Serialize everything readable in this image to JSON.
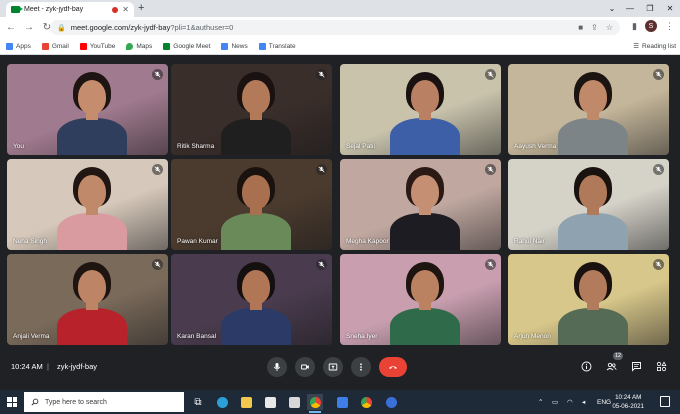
{
  "browser": {
    "tab_title": "Meet - zyk-jydf-bay",
    "new_tab_glyph": "+",
    "url_main": "meet.google.com/zyk-jydf-bay",
    "url_query": "?pli=1&authuser=0",
    "profile_initial": "S",
    "bookmarks": [
      {
        "label": "Apps",
        "icon": "apps-grid-icon",
        "color": "#4285f4"
      },
      {
        "label": "Gmail",
        "icon": "gmail-icon",
        "color": "#ea4335"
      },
      {
        "label": "YouTube",
        "icon": "youtube-icon",
        "color": "#ff0000"
      },
      {
        "label": "Maps",
        "icon": "maps-icon",
        "color": "#34a853"
      },
      {
        "label": "Google Meet",
        "icon": "meet-icon",
        "color": "#00832d"
      },
      {
        "label": "News",
        "icon": "news-icon",
        "color": "#4285f4"
      },
      {
        "label": "Translate",
        "icon": "translate-icon",
        "color": "#4285f4"
      }
    ],
    "reading_list": "Reading list"
  },
  "meet": {
    "participants": [
      {
        "name": "You",
        "bg": "#a07a8e",
        "skin": "#c58c6e",
        "hair": "#1e1412",
        "shirt": "#2f3e5c"
      },
      {
        "name": "Ritik Sharma",
        "bg": "#3a2e2a",
        "skin": "#b27a58",
        "hair": "#1a1210",
        "shirt": "#1f1f1f"
      },
      {
        "name": "Sejal Patil",
        "bg": "#c9c3ac",
        "skin": "#b98064",
        "hair": "#1a1210",
        "shirt": "#3c5fa8"
      },
      {
        "name": "Aayush Verma",
        "bg": "#c4b69a",
        "skin": "#c08a6a",
        "hair": "#1c1411",
        "shirt": "#7d8487"
      },
      {
        "name": "Neha Singh",
        "bg": "#d6c8ba",
        "skin": "#c08a6a",
        "hair": "#221612",
        "shirt": "#d99aa0"
      },
      {
        "name": "Pawan Kumar",
        "bg": "#4b3b2e",
        "skin": "#a8704f",
        "hair": "#1a120f",
        "shirt": "#6b8a5a"
      },
      {
        "name": "Megha Kapoor",
        "bg": "#c0a8a0",
        "skin": "#c48f72",
        "hair": "#2a1914",
        "shirt": "#1c1c22"
      },
      {
        "name": "Rahul Nair",
        "bg": "#d5d2c8",
        "skin": "#b07a5a",
        "hair": "#1a120f",
        "shirt": "#8fa2b0"
      },
      {
        "name": "Anjali Verma",
        "bg": "#7a6a5a",
        "skin": "#bd8565",
        "hair": "#1e1410",
        "shirt": "#b8232b"
      },
      {
        "name": "Karan Bansal",
        "bg": "#4a3c4e",
        "skin": "#b07656",
        "hair": "#151010",
        "shirt": "#2b3a66"
      },
      {
        "name": "Sneha Iyer",
        "bg": "#c99fb0",
        "skin": "#bb8262",
        "hair": "#1e1410",
        "shirt": "#2f6b4a"
      },
      {
        "name": "Arjun Menon",
        "bg": "#d8c78a",
        "skin": "#b27c5c",
        "hair": "#1a120f",
        "shirt": "#556b55"
      }
    ],
    "time": "10:24 AM",
    "separator": "|",
    "meeting_code": "zyk-jydf-bay",
    "participant_count": "12",
    "colors": {
      "hangup": "#ea4335",
      "control": "#3c4043",
      "background": "#202124"
    }
  },
  "taskbar": {
    "search_placeholder": "Type here to search",
    "language": "ENG",
    "clock_time": "10:24 AM",
    "clock_date": "05-06-2021"
  }
}
